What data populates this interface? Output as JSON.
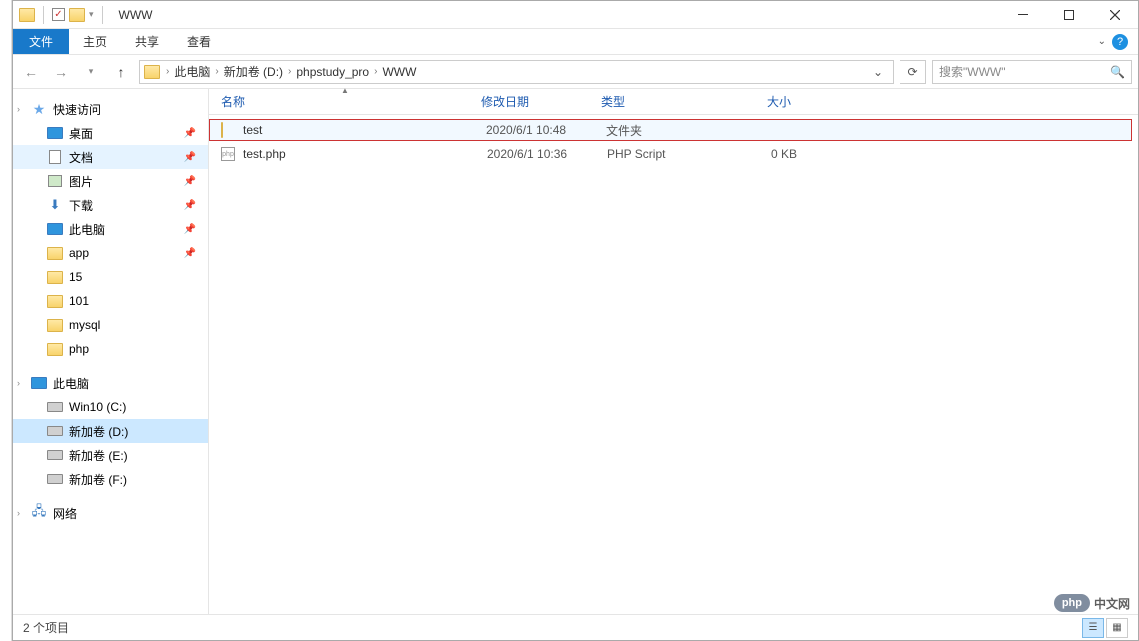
{
  "titlebar": {
    "title": "WWW"
  },
  "ribbon": {
    "file": "文件",
    "home": "主页",
    "share": "共享",
    "view": "查看"
  },
  "address": {
    "segments": [
      "此电脑",
      "新加卷 (D:)",
      "phpstudy_pro",
      "WWW"
    ],
    "search_placeholder": "搜索\"WWW\""
  },
  "sidebar": {
    "quick_access": "快速访问",
    "quick_items": [
      {
        "label": "桌面",
        "icon": "desktop",
        "pinned": true
      },
      {
        "label": "文档",
        "icon": "doc",
        "pinned": true,
        "active": true
      },
      {
        "label": "图片",
        "icon": "pic",
        "pinned": true
      },
      {
        "label": "下载",
        "icon": "download",
        "pinned": true
      },
      {
        "label": "此电脑",
        "icon": "pc",
        "pinned": true
      },
      {
        "label": "app",
        "icon": "folder",
        "pinned": true
      },
      {
        "label": "15",
        "icon": "folder"
      },
      {
        "label": "101",
        "icon": "folder"
      },
      {
        "label": "mysql",
        "icon": "folder"
      },
      {
        "label": "php",
        "icon": "folder"
      }
    ],
    "this_pc": "此电脑",
    "drives": [
      {
        "label": "Win10 (C:)",
        "icon": "drive"
      },
      {
        "label": "新加卷 (D:)",
        "icon": "drive",
        "selected": true
      },
      {
        "label": "新加卷 (E:)",
        "icon": "drive"
      },
      {
        "label": "新加卷 (F:)",
        "icon": "drive"
      }
    ],
    "network": "网络"
  },
  "columns": {
    "name": "名称",
    "date": "修改日期",
    "type": "类型",
    "size": "大小"
  },
  "files": [
    {
      "name": "test",
      "date": "2020/6/1 10:48",
      "type": "文件夹",
      "size": "",
      "icon": "folder",
      "highlight": true
    },
    {
      "name": "test.php",
      "date": "2020/6/1 10:36",
      "type": "PHP Script",
      "size": "0 KB",
      "icon": "php"
    }
  ],
  "status": {
    "count": "2 个项目"
  },
  "watermark": {
    "badge": "php",
    "text": "中文网"
  }
}
